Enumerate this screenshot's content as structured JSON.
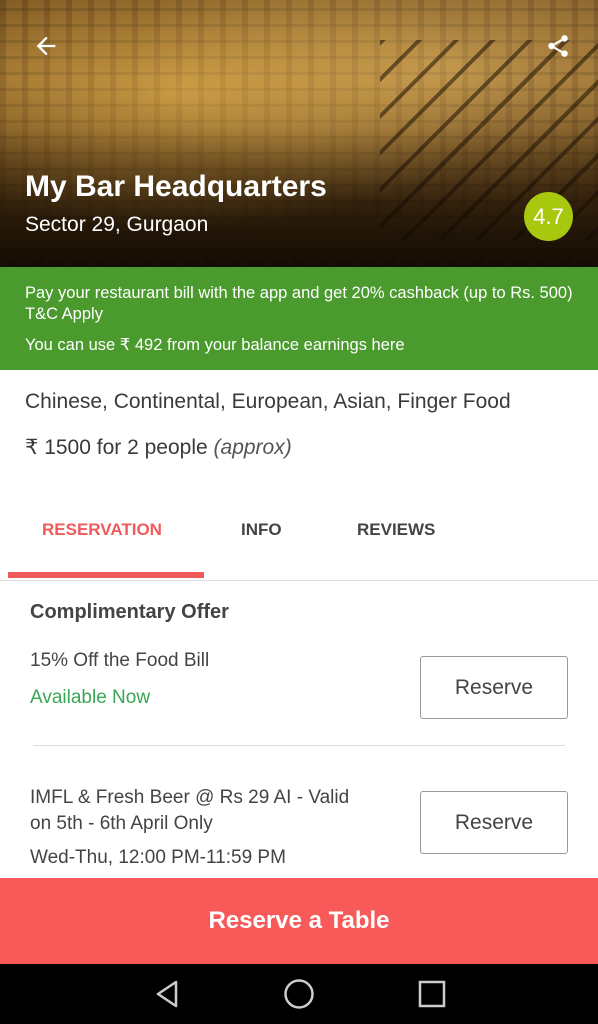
{
  "header": {
    "title": "My Bar Headquarters",
    "location": "Sector 29, Gurgaon",
    "rating": "4.7",
    "back_icon": "arrow-left-icon",
    "share_icon": "share-icon"
  },
  "promo": {
    "line1": "Pay your restaurant bill with the app and get 20% cashback (up to Rs. 500) T&C Apply",
    "line2": "You can use ₹ 492 from your balance earnings here",
    "bg_color": "#4a9a2e"
  },
  "details": {
    "cuisines": "Chinese, Continental, European, Asian, Finger Food",
    "price": "₹ 1500 for 2 people",
    "price_note": "(approx)"
  },
  "tabs": [
    {
      "label": "RESERVATION",
      "active": true
    },
    {
      "label": "INFO",
      "active": false
    },
    {
      "label": "REVIEWS",
      "active": false
    }
  ],
  "reservation": {
    "section_title": "Complimentary Offer",
    "offers": [
      {
        "title": "15% Off the Food Bill",
        "status": "Available Now",
        "button": "Reserve"
      },
      {
        "title": "IMFL & Fresh Beer @ Rs 29 AI - Valid on 5th - 6th April Only",
        "timing": "Wed-Thu, 12:00 PM-11:59 PM",
        "button": "Reserve"
      }
    ]
  },
  "cta": {
    "label": "Reserve a Table",
    "color": "#f85a5a"
  },
  "accent_color": "#f05a5a",
  "system_nav": [
    "back-triangle-icon",
    "home-circle-icon",
    "recents-square-icon"
  ]
}
